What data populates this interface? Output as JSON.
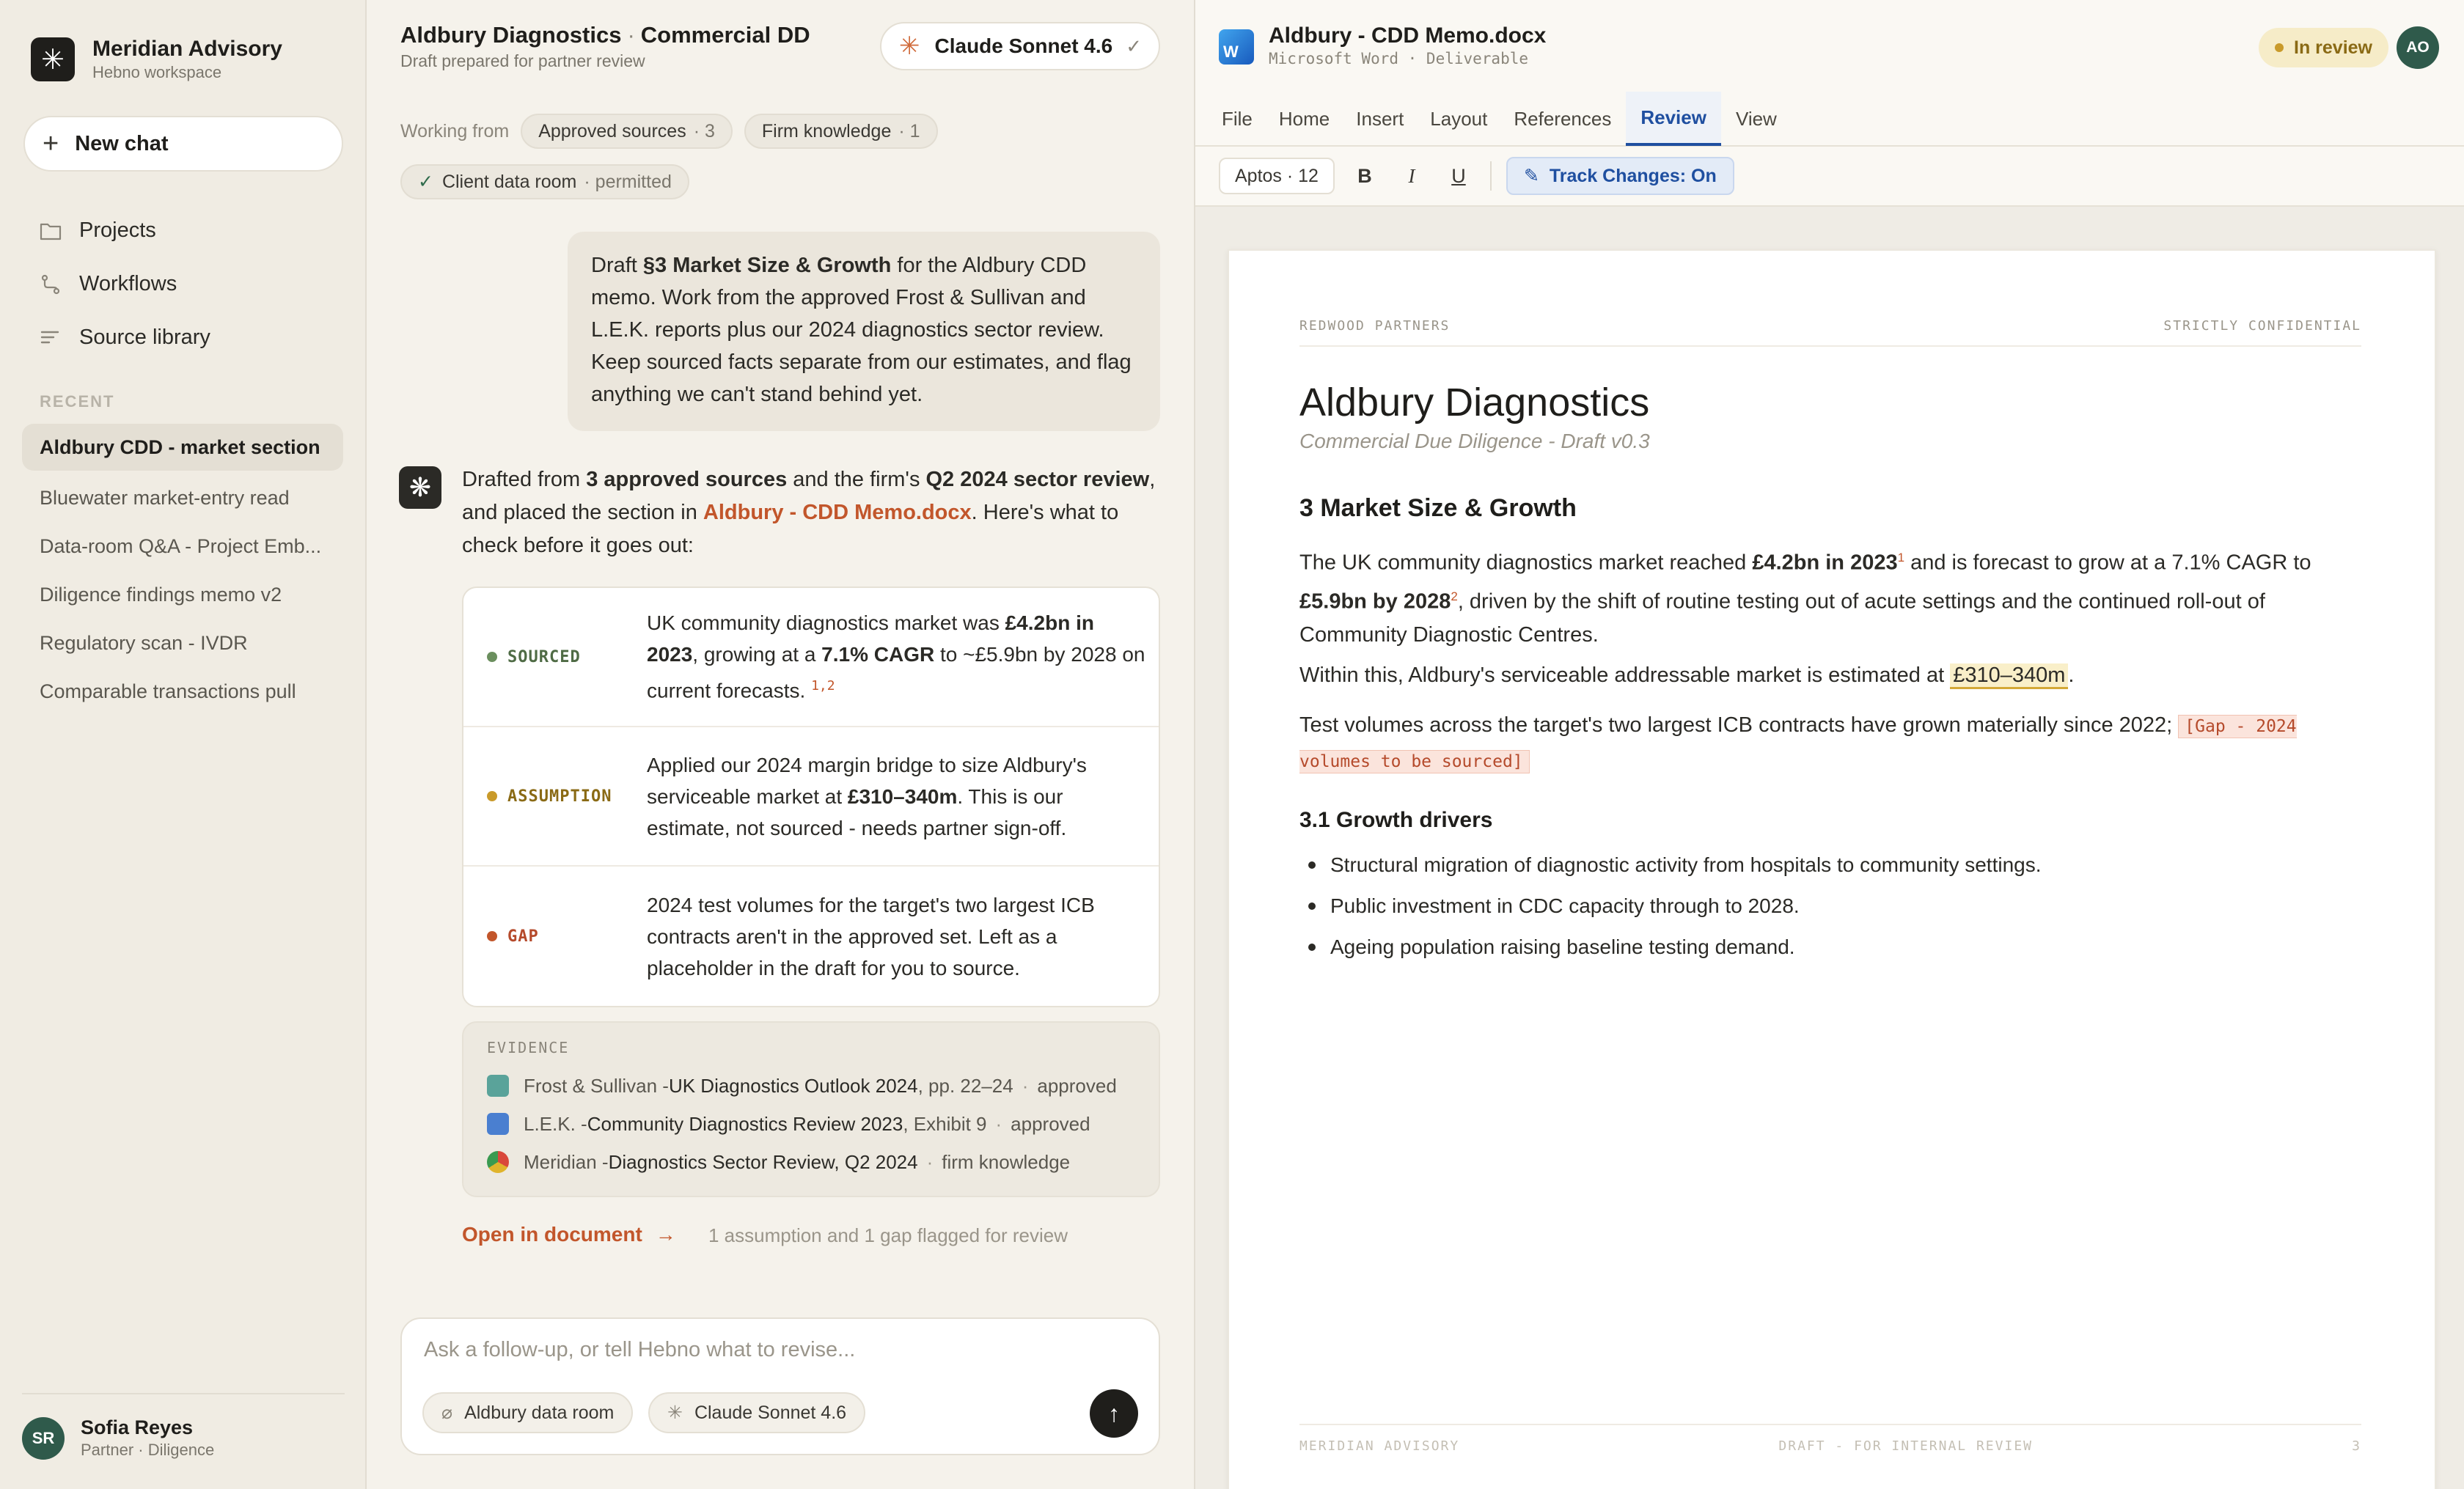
{
  "workspace": {
    "name": "Meridian Advisory",
    "sub": "Hebno workspace"
  },
  "sidebar": {
    "new_chat": "New chat",
    "nav": [
      {
        "label": "Projects",
        "icon": "folder-icon"
      },
      {
        "label": "Workflows",
        "icon": "workflow-icon"
      },
      {
        "label": "Source library",
        "icon": "library-icon"
      }
    ],
    "recent_label": "RECENT",
    "recent": [
      "Aldbury CDD - market section",
      "Bluewater market-entry read",
      "Data-room Q&A - Project Emb...",
      "Diligence findings memo v2",
      "Regulatory scan - IVDR",
      "Comparable transactions pull"
    ],
    "user": {
      "initials": "SR",
      "name": "Sofia Reyes",
      "role": "Partner · Diligence"
    }
  },
  "chat": {
    "title_a": "Aldbury Diagnostics",
    "title_sep": "·",
    "title_b": "Commercial DD",
    "subtitle": "Draft prepared for partner review",
    "model": "Claude Sonnet 4.6",
    "working_from": "Working from",
    "chips": [
      {
        "label": "Approved sources",
        "count": "· 3"
      },
      {
        "label": "Firm knowledge",
        "count": "· 1"
      }
    ],
    "permitted": {
      "label": "Client data room",
      "status": "· permitted"
    },
    "user_msg": {
      "p1": "Draft ",
      "b1": "§3 Market Size & Growth",
      "p2": " for the Aldbury CDD memo. Work from the approved Frost & Sullivan and L.E.K. reports plus our 2024 diagnostics sector review. Keep sourced facts separate from our estimates, and flag anything we can't stand behind yet."
    },
    "reply": {
      "p1": "Drafted from ",
      "b1": "3 approved sources",
      "p2": " and the firm's ",
      "b2": "Q2 2024 sector review",
      "p3": ", and placed the section in ",
      "link": "Aldbury - CDD Memo.docx",
      "p4": ". Here's what to check before it goes out:"
    },
    "flags": [
      {
        "tag": "SOURCED",
        "color": "#6b8f5e",
        "text_color": "#4f6b45",
        "p1": "UK community diagnostics market was ",
        "b1": "£4.2bn in 2023",
        "p2": ", growing at a ",
        "b2": "7.1% CAGR",
        "p3": " to ~£5.9bn by 2028 on current forecasts. ",
        "sup": "1,2"
      },
      {
        "tag": "ASSUMPTION",
        "color": "#c99a2a",
        "text_color": "#8a6a15",
        "p1": "Applied our 2024 margin bridge to size Aldbury's serviceable market at ",
        "b1": "£310–340m",
        "p2": ". This is our estimate, not sourced - needs partner sign-off."
      },
      {
        "tag": "GAP",
        "color": "#c2562b",
        "text_color": "#b54a2b",
        "p1": "2024 test volumes for the target's two largest ICB contracts aren't in the approved set. Left as a placeholder in the draft for you to source."
      }
    ],
    "evidence": {
      "label": "EVIDENCE",
      "rows": [
        {
          "pub": "Frost & Sullivan - ",
          "src": "UK Diagnostics Outlook 2024",
          "loc": ", pp. 22–24",
          "status": "approved",
          "icon": "frost-sullivan-icon",
          "color": "#5aa39a"
        },
        {
          "pub": "L.E.K. - ",
          "src": "Community Diagnostics Review 2023",
          "loc": ", Exhibit 9",
          "status": "approved",
          "icon": "lek-icon",
          "color": "#4a7fd0"
        },
        {
          "pub": "Meridian - ",
          "src": "Diagnostics Sector Review, Q2 2024",
          "loc": "",
          "status": "firm knowledge",
          "icon": "chrome-icon",
          "color": "#e0b42c"
        }
      ]
    },
    "open_doc": "Open in document",
    "review_note": "1 assumption and 1 gap flagged for review",
    "composer": {
      "placeholder": "Ask a follow-up, or tell Hebno what to revise...",
      "chip_a": "Aldbury data room",
      "chip_b": "Claude Sonnet 4.6"
    }
  },
  "doc": {
    "file": "Aldbury - CDD Memo.docx",
    "app": "Microsoft Word · Deliverable",
    "status": "In review",
    "avatar": "AO",
    "tabs": [
      "File",
      "Home",
      "Insert",
      "Layout",
      "References",
      "Review",
      "View"
    ],
    "active_tab": "Review",
    "font": "Aptos · 12",
    "track": "Track Changes: On",
    "page": {
      "top_left": "REDWOOD PARTNERS",
      "top_right": "STRICTLY CONFIDENTIAL",
      "h1": "Aldbury Diagnostics",
      "sub": "Commercial Due Diligence - Draft v0.3",
      "h2": "3  Market Size & Growth",
      "p1": {
        "a": "The UK community diagnostics market reached ",
        "b": "£4.2bn in 2023",
        "s1": "1",
        "c": " and is forecast to grow at a 7.1% CAGR to ",
        "d": "£5.9bn by 2028",
        "s2": "2",
        "e": ", driven by the shift of routine testing out of acute settings and the continued roll-out of Community Diagnostic Centres."
      },
      "p2": {
        "a": "Within this, Aldbury's serviceable addressable market is estimated at ",
        "hl": "£310–340m",
        "b": "."
      },
      "p3": {
        "a": "Test volumes across the target's two largest ICB contracts have grown materially since 2022; ",
        "gap": "[Gap - 2024 volumes to be sourced]"
      },
      "h3": "3.1  Growth drivers",
      "bullets": [
        "Structural migration of diagnostic activity from hospitals to community settings.",
        "Public investment in CDC capacity through to 2028.",
        "Ageing population raising baseline testing demand."
      ],
      "foot_left": "MERIDIAN ADVISORY",
      "foot_mid": "DRAFT - FOR INTERNAL REVIEW",
      "foot_right": "3"
    }
  }
}
